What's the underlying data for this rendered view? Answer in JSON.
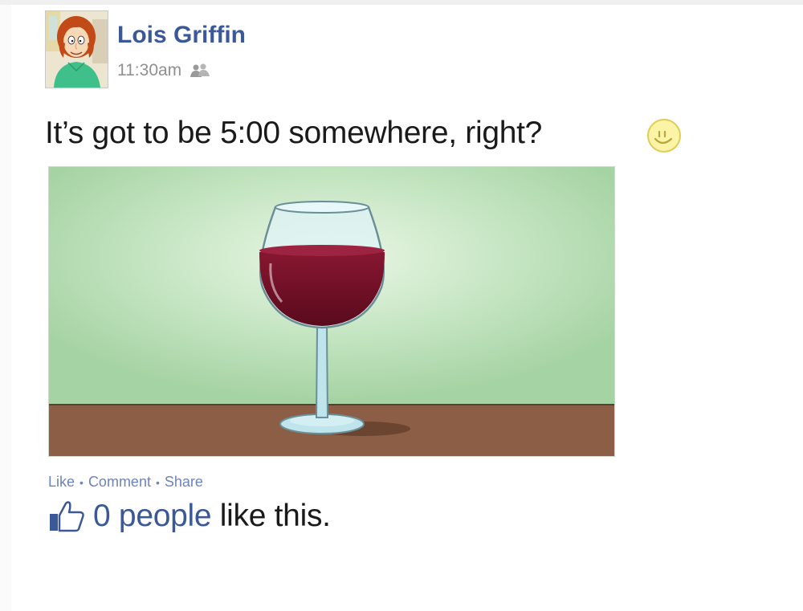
{
  "post": {
    "author_name": "Lois Griffin",
    "timestamp": "11:30am",
    "audience_icon": "friends-icon",
    "status_text": "It’s got to be 5:00 somewhere, right?",
    "status_emoticon": "smiley-icon",
    "photo_subject": "wine-glass-image"
  },
  "actions": {
    "like_label": "Like",
    "comment_label": "Comment",
    "share_label": "Share",
    "separator": "•"
  },
  "likes": {
    "icon": "thumbs-up-icon",
    "count_text": "0 people",
    "suffix_text": "like this."
  },
  "colors": {
    "link_blue": "#3b5998",
    "action_blue": "#6d84b4",
    "wine": "#6b0f26",
    "table_brown": "#8b5e45",
    "photo_green": "#a6d3a4"
  }
}
